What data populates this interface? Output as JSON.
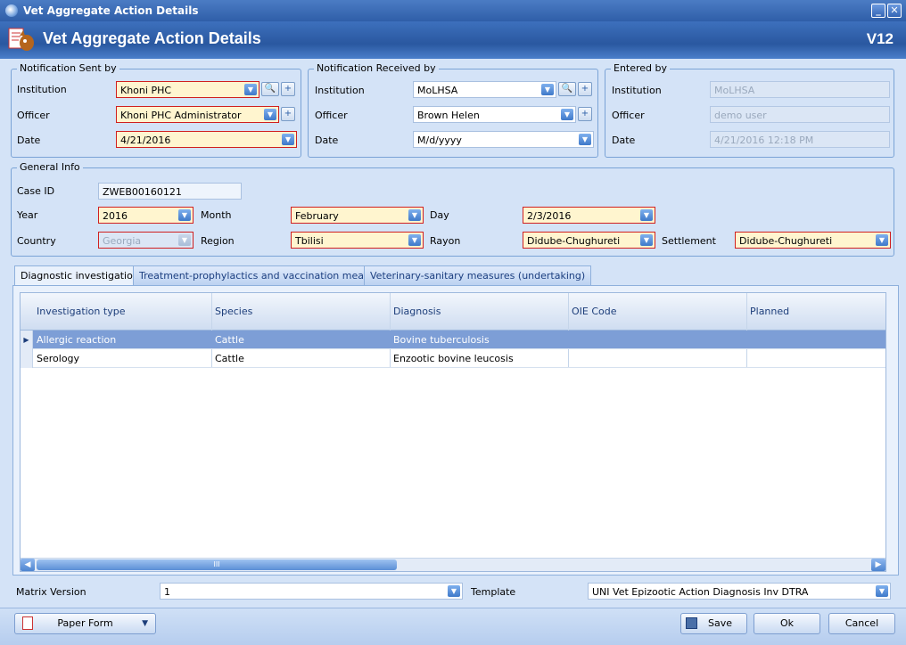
{
  "window": {
    "title": "Vet Aggregate Action Details"
  },
  "header": {
    "title": "Vet Aggregate Action Details",
    "version": "V12"
  },
  "notification_sent": {
    "legend": "Notification Sent by",
    "institution_label": "Institution",
    "institution": "Khoni PHC",
    "officer_label": "Officer",
    "officer": "Khoni PHC Administrator",
    "date_label": "Date",
    "date": "4/21/2016"
  },
  "notification_received": {
    "legend": "Notification Received by",
    "institution_label": "Institution",
    "institution": "MoLHSA",
    "officer_label": "Officer",
    "officer": "Brown Helen",
    "date_label": "Date",
    "date": "M/d/yyyy"
  },
  "entered_by": {
    "legend": "Entered by",
    "institution_label": "Institution",
    "institution": "MoLHSA",
    "officer_label": "Officer",
    "officer": "demo user",
    "date_label": "Date",
    "date": "4/21/2016 12:18 PM"
  },
  "general_info": {
    "legend": "General Info",
    "case_id_label": "Case ID",
    "case_id": "ZWEB00160121",
    "year_label": "Year",
    "year": "2016",
    "month_label": "Month",
    "month": "February",
    "day_label": "Day",
    "day": "2/3/2016",
    "country_label": "Country",
    "country": "Georgia",
    "region_label": "Region",
    "region": "Tbilisi",
    "rayon_label": "Rayon",
    "rayon": "Didube-Chughureti",
    "settlement_label": "Settlement",
    "settlement": "Didube-Chughureti"
  },
  "tabs": [
    {
      "label": "Diagnostic investigations"
    },
    {
      "label": "Treatment-prophylactics and vaccination measures"
    },
    {
      "label": "Veterinary-sanitary measures (undertaking)"
    }
  ],
  "grid": {
    "columns": [
      "Investigation type",
      "Species",
      "Diagnosis",
      "OIE Code",
      "Planned"
    ],
    "rows": [
      [
        "Allergic reaction",
        "Cattle",
        "Bovine tuberculosis",
        "",
        ""
      ],
      [
        "Serology",
        "Cattle",
        "Enzootic bovine leucosis",
        "",
        ""
      ]
    ],
    "scroll_grip": "III"
  },
  "matrix": {
    "version_label": "Matrix Version",
    "version": "1",
    "template_label": "Template",
    "template": "UNI Vet Epizootic Action Diagnosis Inv DTRA"
  },
  "footer": {
    "paper_form": "Paper Form",
    "save": "Save",
    "ok": "Ok",
    "cancel": "Cancel"
  },
  "colors": {
    "required_border": "#d02020",
    "required_fill": "#fff5cf",
    "selected_row": "#7d9ed6",
    "header_blue": "#2a58a0"
  }
}
